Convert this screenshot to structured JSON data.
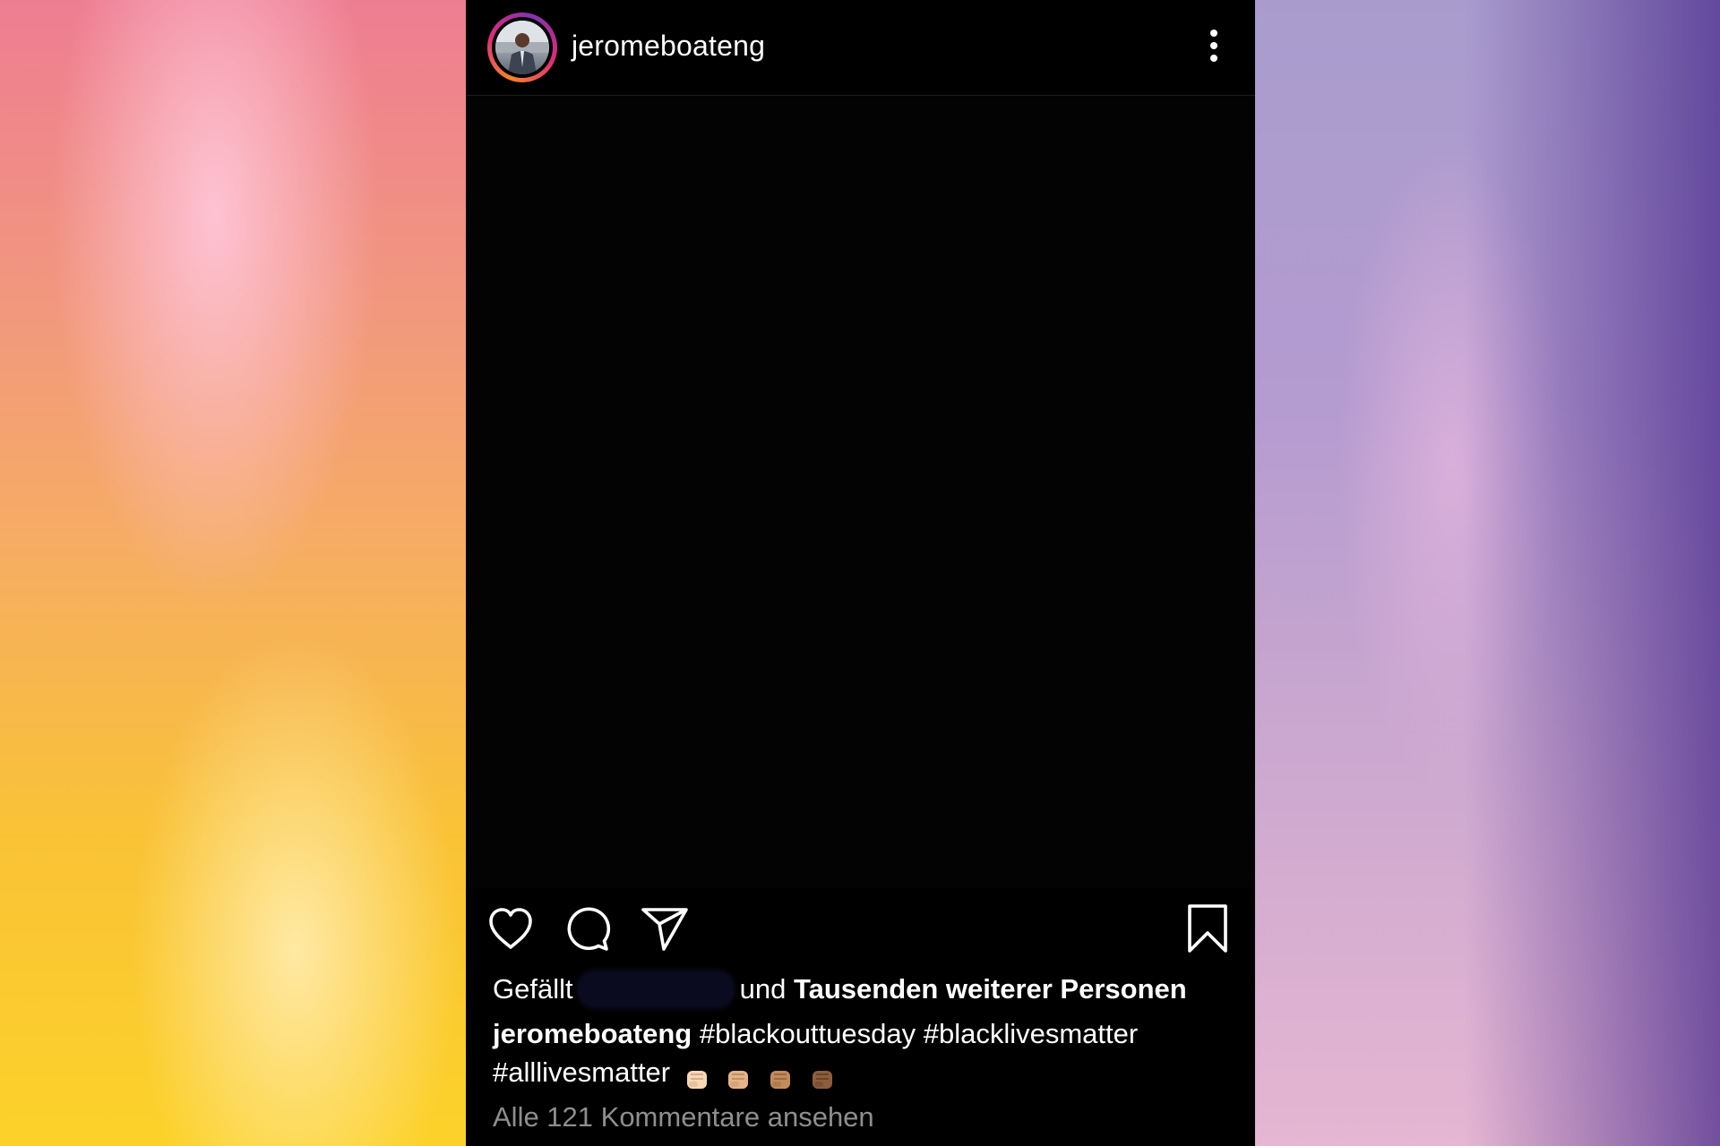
{
  "post": {
    "username": "jeromeboateng",
    "likes": {
      "prefix": "Gefällt",
      "connector": "und",
      "others": "Tausenden weiterer Personen"
    },
    "caption": {
      "username": "jeromeboateng",
      "text_line1": "#blackouttuesday #blacklivesmatter",
      "text_line2": "#alllivesmatter",
      "emojis": [
        "fist-light",
        "fist-medium-light",
        "fist-medium",
        "fist-medium-dark"
      ]
    },
    "view_comments": "Alle 121 Kommentare ansehen"
  },
  "colors": {
    "background": "#000000",
    "text": "#ffffff",
    "muted_text": "#8e8e8e",
    "story_ring": [
      "#f58529",
      "#dd2a7b",
      "#8134af"
    ]
  }
}
